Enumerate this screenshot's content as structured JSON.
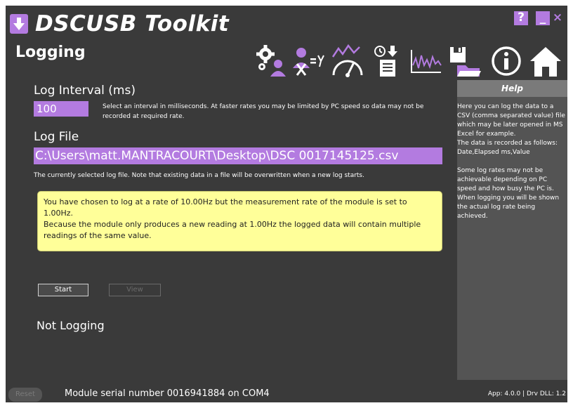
{
  "app": {
    "title": "DSCUSB Toolkit",
    "help_glyph": "?",
    "minimize_glyph": "_",
    "close_glyph": "×"
  },
  "page": {
    "title": "Logging"
  },
  "toolbar": [
    {
      "name": "settings-user-icon"
    },
    {
      "name": "calibration-formula-icon"
    },
    {
      "name": "gauge-chart-icon"
    },
    {
      "name": "timer-download-icon"
    },
    {
      "name": "waveform-graph-icon"
    },
    {
      "name": "save-folder-icon"
    },
    {
      "name": "info-icon"
    },
    {
      "name": "home-icon"
    }
  ],
  "logging": {
    "interval_label": "Log Interval (ms)",
    "interval_value": "100",
    "interval_hint": "Select an interval in milliseconds. At faster rates you may be limited by PC speed so data may not be recorded at required rate.",
    "file_label": "Log File",
    "file_path": "C:\\Users\\matt.MANTRACOURT\\Desktop\\DSC 0017145125.csv",
    "file_hint": "The currently selected log file. Note that existing data in a file will be overwritten when a new log starts.",
    "warning": "You have chosen to log at a rate of 10.00Hz but the measurement rate of the module is set to 1.00Hz.\nBecause the module only produces a new reading at 1.00Hz the logged data will contain multiple readings of the same value.",
    "start_label": "Start",
    "view_label": "View",
    "status": "Not Logging"
  },
  "help": {
    "title": "Help",
    "body": "Here you can log the data to a CSV (comma separated value) file which may be later opened in MS Excel for example.\n The data is recorded as follows: Date,Elapsed ms,Value\n\nSome log rates may not be achievable depending on PC speed and how busy the PC is. When logging you will be shown the actual log rate being achieved."
  },
  "statusbar": {
    "reset_label": "Reset",
    "serial_text": "Module serial number 0016941884 on COM4",
    "version_text": "App: 4.0.0 | Drv DLL: 1.2"
  },
  "colors": {
    "accent": "#b37be0",
    "background": "#3a3a3a",
    "panel": "#545454",
    "warning_bg": "#ffff99"
  }
}
